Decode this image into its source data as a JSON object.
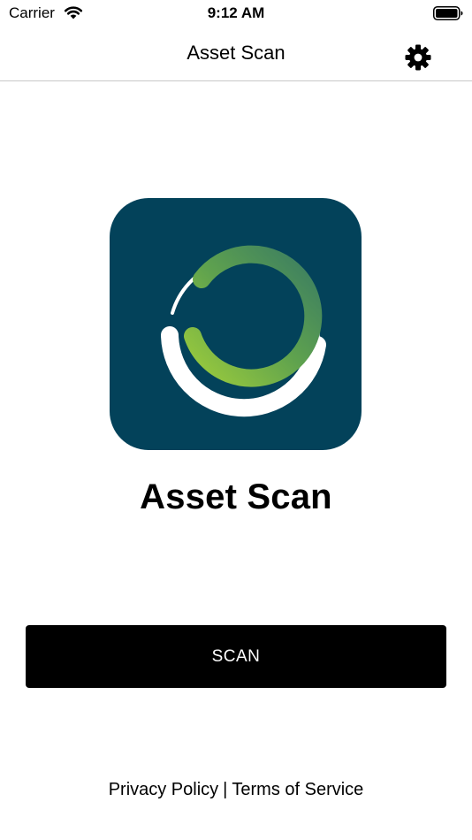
{
  "status_bar": {
    "carrier": "Carrier",
    "time": "9:12 AM",
    "wifi_icon": "wifi-icon",
    "battery_icon": "battery-icon"
  },
  "nav": {
    "title": "Asset Scan",
    "settings_icon": "gear-icon"
  },
  "logo": {
    "background_color": "#03425a",
    "accent_colors": [
      "#8dc63f",
      "#3e8a5c"
    ]
  },
  "app_title": "Asset Scan",
  "scan_button": {
    "label": "SCAN",
    "background_color": "#000000"
  },
  "footer": {
    "privacy_label": "Privacy Policy",
    "separator": "|",
    "terms_label": "Terms of Service"
  }
}
